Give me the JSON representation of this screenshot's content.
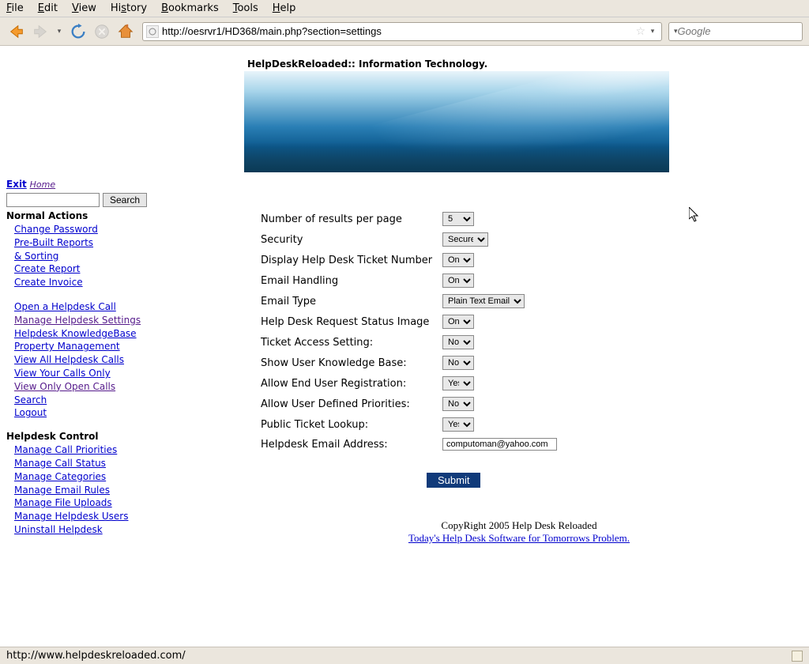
{
  "menubar": [
    "File",
    "Edit",
    "View",
    "History",
    "Bookmarks",
    "Tools",
    "Help"
  ],
  "url": "http://oesrvr1/HD368/main.php?section=settings",
  "search_engine_placeholder": "Google",
  "banner_title": "HelpDeskReloaded:: Information Technology.",
  "sidebar": {
    "exit": "Exit",
    "home": "Home",
    "search_btn": "Search",
    "section_normal": "Normal Actions",
    "section_control": "Helpdesk Control",
    "links1": [
      {
        "t": "Change Password",
        "v": false
      },
      {
        "t": "Pre-Built Reports",
        "v": false
      },
      {
        "t": "& Sorting",
        "v": false
      },
      {
        "t": "Create Report",
        "v": false
      },
      {
        "t": "Create Invoice",
        "v": false
      }
    ],
    "links2": [
      {
        "t": "Open a Helpdesk Call",
        "v": false
      },
      {
        "t": "Manage Helpdesk Settings",
        "v": true
      },
      {
        "t": "Helpdesk KnowledgeBase",
        "v": false
      },
      {
        "t": "Property Management",
        "v": false
      },
      {
        "t": "View All Helpdesk Calls",
        "v": false
      },
      {
        "t": "View Your Calls Only",
        "v": false
      },
      {
        "t": "View Only Open Calls",
        "v": true
      },
      {
        "t": "Search",
        "v": false
      },
      {
        "t": "Logout",
        "v": false
      }
    ],
    "links3": [
      {
        "t": "Manage Call Priorities",
        "v": false
      },
      {
        "t": "Manage Call Status",
        "v": false
      },
      {
        "t": "Manage Categories",
        "v": false
      },
      {
        "t": "Manage Email Rules",
        "v": false
      },
      {
        "t": "Manage File Uploads",
        "v": false
      },
      {
        "t": "Manage Helpdesk Users",
        "v": false
      },
      {
        "t": "Uninstall Helpdesk",
        "v": false
      }
    ]
  },
  "settings": [
    {
      "label": "Number of results per page",
      "type": "select",
      "value": "5",
      "w": 40
    },
    {
      "label": "Security",
      "type": "select",
      "value": "Secure",
      "w": 58
    },
    {
      "label": "Display Help Desk Ticket Number",
      "type": "select",
      "value": "On",
      "w": 40
    },
    {
      "label": "Email Handling",
      "type": "select",
      "value": "On",
      "w": 40
    },
    {
      "label": "Email Type",
      "type": "select",
      "value": "Plain Text Email",
      "w": 104
    },
    {
      "label": "Help Desk Request Status Image",
      "type": "select",
      "value": "On",
      "w": 40
    },
    {
      "label": "Ticket Access Setting:",
      "type": "select",
      "value": "No",
      "w": 40
    },
    {
      "label": "Show User Knowledge Base:",
      "type": "select",
      "value": "No",
      "w": 40
    },
    {
      "label": "Allow End User Registration:",
      "type": "select",
      "value": "Yes",
      "w": 40
    },
    {
      "label": "Allow User Defined Priorities:",
      "type": "select",
      "value": "No",
      "w": 40
    },
    {
      "label": "Public Ticket Lookup:",
      "type": "select",
      "value": "Yes",
      "w": 40
    },
    {
      "label": "Helpdesk Email Address:",
      "type": "text",
      "value": "computoman@yahoo.com"
    }
  ],
  "submit_label": "Submit",
  "footer": {
    "copyright": "CopyRight 2005 Help Desk Reloaded",
    "tagline": "Today's Help Desk Software for Tomorrows Problem."
  },
  "status_text": "http://www.helpdeskreloaded.com/"
}
